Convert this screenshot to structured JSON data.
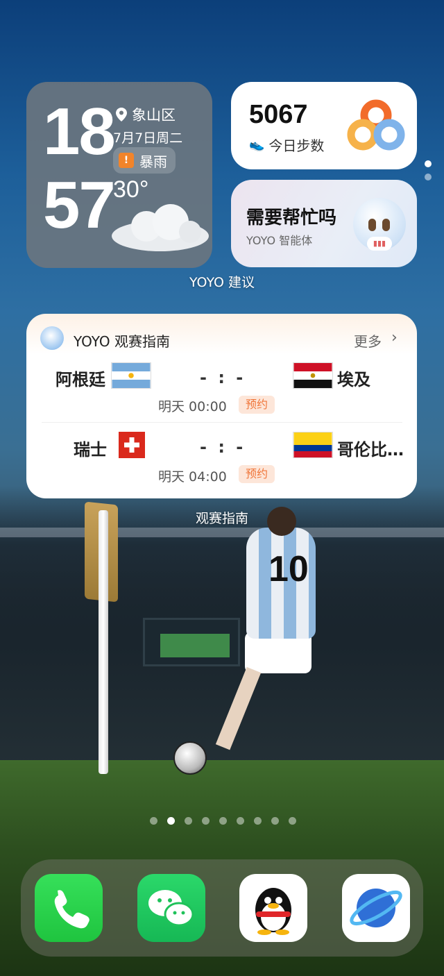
{
  "weather": {
    "hour": "18",
    "minute": "57",
    "location": "象山区",
    "date": "7月7日周二",
    "alert": "暴雨",
    "temperature": "30°"
  },
  "steps": {
    "count": "5067",
    "label": "今日步数"
  },
  "assistant": {
    "title": "需要帮忙吗",
    "subtitle": "YOYO 智能体"
  },
  "widget_group_label": "YOYO 建议",
  "guide": {
    "title": "YOYO 观赛指南",
    "more": "更多",
    "chevron": "›",
    "matches": [
      {
        "home": "阿根廷",
        "away": "埃及",
        "score": "- : -",
        "time": "明天 00:00",
        "action": "预约"
      },
      {
        "home": "瑞士",
        "away": "哥伦比…",
        "score": "- : -",
        "time": "明天 04:00",
        "action": "预约"
      }
    ],
    "label": "观赛指南"
  },
  "page_indicator": {
    "count": 9,
    "active": 1
  },
  "dock": {
    "apps": [
      "phone-app",
      "wechat-app",
      "qq-app",
      "browser-app"
    ]
  },
  "colors": {
    "alert": "#f2842a",
    "book_bg": "#fde6d9",
    "book_text": "#f0763a",
    "phone": "#22d34a",
    "wechat": "#1fc25a"
  }
}
